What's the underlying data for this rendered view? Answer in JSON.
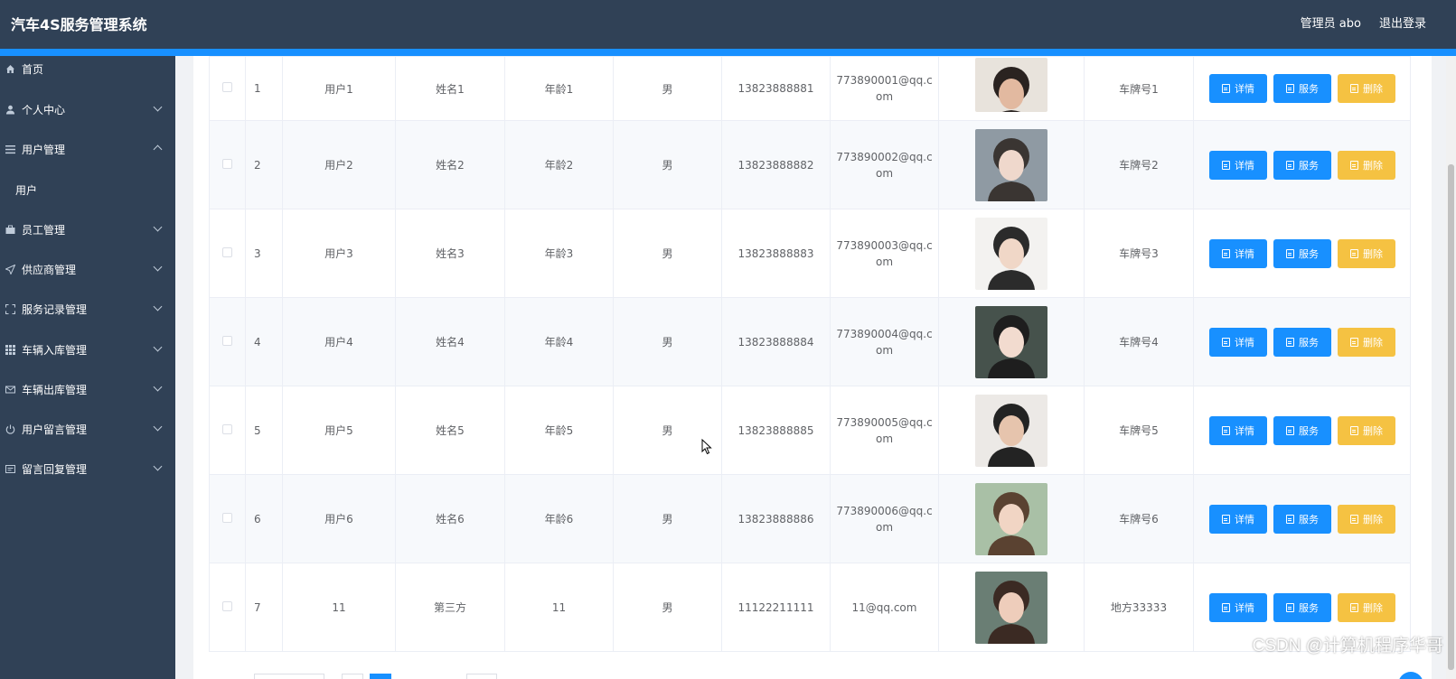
{
  "header": {
    "title": "汽车4S服务管理系统",
    "admin_label": "管理员 abo",
    "logout_label": "退出登录"
  },
  "colors": {
    "header_bg": "#304156",
    "accent": "#1890ff",
    "warning": "#f5c242"
  },
  "sidebar": {
    "items": [
      {
        "label": "首页",
        "icon": "home-icon"
      },
      {
        "label": "个人中心",
        "icon": "user-icon"
      },
      {
        "label": "用户管理",
        "icon": "list-icon",
        "expanded": true,
        "children": [
          {
            "label": "用户"
          }
        ]
      },
      {
        "label": "员工管理",
        "icon": "briefcase-icon"
      },
      {
        "label": "供应商管理",
        "icon": "send-icon"
      },
      {
        "label": "服务记录管理",
        "icon": "fullscreen-icon"
      },
      {
        "label": "车辆入库管理",
        "icon": "grid-icon"
      },
      {
        "label": "车辆出库管理",
        "icon": "mail-icon"
      },
      {
        "label": "用户留言管理",
        "icon": "power-icon"
      },
      {
        "label": "留言回复管理",
        "icon": "card-icon"
      }
    ]
  },
  "table": {
    "rows": [
      {
        "index": "1",
        "user": "用户1",
        "name": "姓名1",
        "age": "年龄1",
        "sex": "男",
        "phone": "13823888881",
        "email": "773890001@qq.com",
        "plate": "车牌号1"
      },
      {
        "index": "2",
        "user": "用户2",
        "name": "姓名2",
        "age": "年龄2",
        "sex": "男",
        "phone": "13823888882",
        "email": "773890002@qq.com",
        "plate": "车牌号2"
      },
      {
        "index": "3",
        "user": "用户3",
        "name": "姓名3",
        "age": "年龄3",
        "sex": "男",
        "phone": "13823888883",
        "email": "773890003@qq.com",
        "plate": "车牌号3"
      },
      {
        "index": "4",
        "user": "用户4",
        "name": "姓名4",
        "age": "年龄4",
        "sex": "男",
        "phone": "13823888884",
        "email": "773890004@qq.com",
        "plate": "车牌号4"
      },
      {
        "index": "5",
        "user": "用户5",
        "name": "姓名5",
        "age": "年龄5",
        "sex": "男",
        "phone": "13823888885",
        "email": "773890005@qq.com",
        "plate": "车牌号5"
      },
      {
        "index": "6",
        "user": "用户6",
        "name": "姓名6",
        "age": "年龄6",
        "sex": "男",
        "phone": "13823888886",
        "email": "773890006@qq.com",
        "plate": "车牌号6"
      },
      {
        "index": "7",
        "user": "11",
        "name": "第三方",
        "age": "11",
        "sex": "男",
        "phone": "11122211111",
        "email": "11@qq.com",
        "plate": "地方33333"
      }
    ],
    "actions": {
      "detail": "详情",
      "service": "服务",
      "delete": "删除"
    }
  },
  "watermark": "CSDN @计算机程序华哥"
}
